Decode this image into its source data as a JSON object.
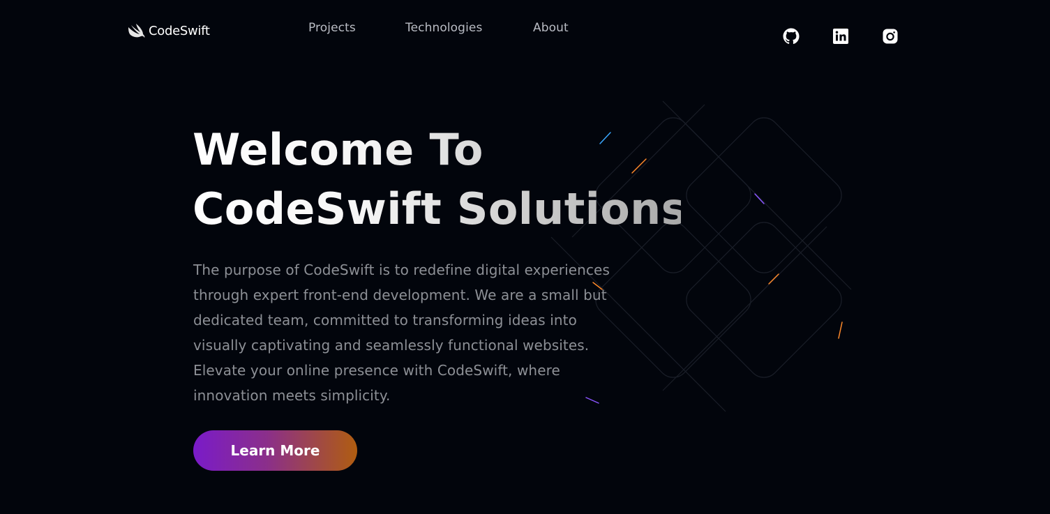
{
  "brand": {
    "name": "CodeSwift",
    "icon": "swift-logo-icon"
  },
  "nav": {
    "links": [
      {
        "label": "Projects"
      },
      {
        "label": "Technologies"
      },
      {
        "label": "About"
      }
    ],
    "socials": [
      {
        "icon": "github-icon"
      },
      {
        "icon": "linkedin-icon"
      },
      {
        "icon": "instagram-icon"
      }
    ]
  },
  "hero": {
    "title_line1": "Welcome To",
    "title_line2": "CodeSwift Solutions",
    "description_lines": [
      "The purpose of CodeSwift is to redefine digital experiences",
      "through expert front-end development. We are a small but",
      "dedicated team, committed to transforming ideas into",
      "visually captivating and seamlessly functional websites.",
      "Elevate your online presence with CodeSwift, where",
      "innovation meets simplicity."
    ],
    "cta_label": "Learn More"
  },
  "colors": {
    "background": "#02050c",
    "cta_gradient_start": "#7a1bc9",
    "cta_gradient_end": "#b05d10",
    "text_muted": "#8d9096"
  }
}
